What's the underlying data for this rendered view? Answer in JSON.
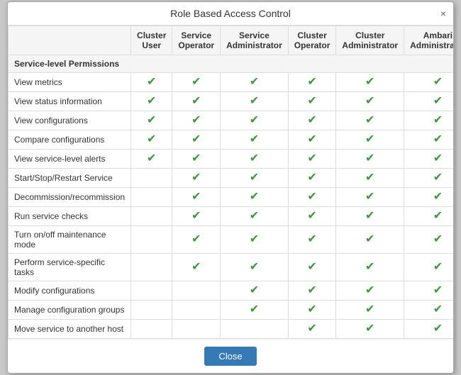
{
  "dialog": {
    "title": "Role Based Access Control",
    "close_label": "Close",
    "close_icon": "×"
  },
  "table": {
    "columns": [
      {
        "id": "feature",
        "label": ""
      },
      {
        "id": "cluster_user",
        "label": "Cluster User"
      },
      {
        "id": "service_operator",
        "label": "Service Operator"
      },
      {
        "id": "service_admin",
        "label": "Service Administrator"
      },
      {
        "id": "cluster_operator",
        "label": "Cluster Operator"
      },
      {
        "id": "cluster_admin",
        "label": "Cluster Administrator"
      },
      {
        "id": "ambari_admin",
        "label": "Ambari Administrator"
      }
    ],
    "sections": [
      {
        "header": "Service-level Permissions",
        "rows": [
          {
            "feature": "View metrics",
            "checks": [
              true,
              true,
              true,
              true,
              true,
              true
            ]
          },
          {
            "feature": "View status information",
            "checks": [
              true,
              true,
              true,
              true,
              true,
              true
            ]
          },
          {
            "feature": "View configurations",
            "checks": [
              true,
              true,
              true,
              true,
              true,
              true
            ]
          },
          {
            "feature": "Compare configurations",
            "checks": [
              true,
              true,
              true,
              true,
              true,
              true
            ]
          },
          {
            "feature": "View service-level alerts",
            "checks": [
              true,
              true,
              true,
              true,
              true,
              true
            ]
          },
          {
            "feature": "Start/Stop/Restart Service",
            "checks": [
              false,
              true,
              true,
              true,
              true,
              true
            ]
          },
          {
            "feature": "Decommission/recommission",
            "checks": [
              false,
              true,
              true,
              true,
              true,
              true
            ]
          },
          {
            "feature": "Run service checks",
            "checks": [
              false,
              true,
              true,
              true,
              true,
              true
            ]
          },
          {
            "feature": "Turn on/off maintenance mode",
            "checks": [
              false,
              true,
              true,
              true,
              true,
              true
            ]
          },
          {
            "feature": "Perform service-specific tasks",
            "checks": [
              false,
              true,
              true,
              true,
              true,
              true
            ]
          },
          {
            "feature": "Modify configurations",
            "checks": [
              false,
              false,
              true,
              true,
              true,
              true
            ]
          },
          {
            "feature": "Manage configuration groups",
            "checks": [
              false,
              false,
              true,
              true,
              true,
              true
            ]
          },
          {
            "feature": "Move service to another host",
            "checks": [
              false,
              false,
              false,
              true,
              true,
              true
            ]
          }
        ]
      }
    ]
  }
}
